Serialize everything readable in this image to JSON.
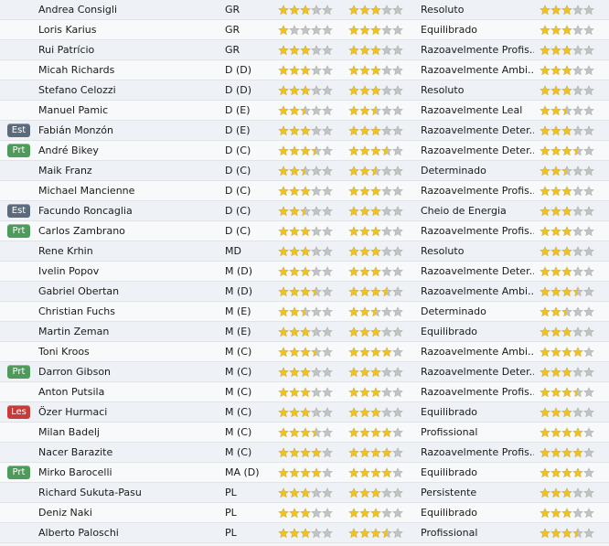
{
  "colors": {
    "Est": "#5b6b7d",
    "Prt": "#4e9a5a",
    "Les": "#c83b3b",
    "star_full": "#f2c21b",
    "star_empty": "#bfc4cb"
  },
  "rows": [
    {
      "name": "Andrea Consigli",
      "pos": "GR",
      "badge": "",
      "ca": 3,
      "pa": 3,
      "personality": "Resoluto",
      "r": 3
    },
    {
      "name": "Loris Karius",
      "pos": "GR",
      "badge": "",
      "ca": 1,
      "pa": 3,
      "personality": "Equilibrado",
      "r": 3
    },
    {
      "name": "Rui Patrício",
      "pos": "GR",
      "badge": "",
      "ca": 3,
      "pa": 3,
      "personality": "Razoavelmente Profis...",
      "r": 3
    },
    {
      "name": "Micah Richards",
      "pos": "D (D)",
      "badge": "",
      "ca": 3,
      "pa": 3,
      "personality": "Razoavelmente Ambi...",
      "r": 3
    },
    {
      "name": "Stefano Celozzi",
      "pos": "D (D)",
      "badge": "",
      "ca": 3,
      "pa": 3,
      "personality": "Resoluto",
      "r": 3
    },
    {
      "name": "Manuel Pamic",
      "pos": "D (E)",
      "badge": "",
      "ca": 2.5,
      "pa": 2.5,
      "personality": "Razoavelmente Leal",
      "r": 2.5
    },
    {
      "name": "Fabián Monzón",
      "pos": "D (E)",
      "badge": "Est",
      "ca": 3,
      "pa": 3,
      "personality": "Razoavelmente Deter...",
      "r": 3
    },
    {
      "name": "André Bikey",
      "pos": "D (C)",
      "badge": "Prt",
      "ca": 3.5,
      "pa": 3.5,
      "personality": "Razoavelmente Deter...",
      "r": 3.5
    },
    {
      "name": "Maik Franz",
      "pos": "D (C)",
      "badge": "",
      "ca": 2.5,
      "pa": 2.5,
      "personality": "Determinado",
      "r": 2.5
    },
    {
      "name": "Michael Mancienne",
      "pos": "D (C)",
      "badge": "",
      "ca": 3,
      "pa": 3,
      "personality": "Razoavelmente Profis...",
      "r": 3
    },
    {
      "name": "Facundo Roncaglia",
      "pos": "D (C)",
      "badge": "Est",
      "ca": 2.5,
      "pa": 3,
      "personality": "Cheio de Energia",
      "r": 3
    },
    {
      "name": "Carlos Zambrano",
      "pos": "D (C)",
      "badge": "Prt",
      "ca": 3,
      "pa": 3,
      "personality": "Razoavelmente Profis...",
      "r": 3
    },
    {
      "name": "Rene Krhin",
      "pos": "MD",
      "badge": "",
      "ca": 3,
      "pa": 3,
      "personality": "Resoluto",
      "r": 3
    },
    {
      "name": "Ivelin Popov",
      "pos": "M (D)",
      "badge": "",
      "ca": 3,
      "pa": 3,
      "personality": "Razoavelmente Deter...",
      "r": 3
    },
    {
      "name": "Gabriel Obertan",
      "pos": "M (D)",
      "badge": "",
      "ca": 3.5,
      "pa": 3.5,
      "personality": "Razoavelmente Ambi...",
      "r": 3.5
    },
    {
      "name": "Christian Fuchs",
      "pos": "M (E)",
      "badge": "",
      "ca": 2.5,
      "pa": 2.5,
      "personality": "Determinado",
      "r": 2.5
    },
    {
      "name": "Martin Zeman",
      "pos": "M (E)",
      "badge": "",
      "ca": 3,
      "pa": 3,
      "personality": "Equilibrado",
      "r": 3
    },
    {
      "name": "Toni Kroos",
      "pos": "M (C)",
      "badge": "",
      "ca": 3.5,
      "pa": 4,
      "personality": "Razoavelmente Ambi...",
      "r": 4
    },
    {
      "name": "Darron Gibson",
      "pos": "M (C)",
      "badge": "Prt",
      "ca": 3,
      "pa": 3,
      "personality": "Razoavelmente Deter...",
      "r": 3
    },
    {
      "name": "Anton Putsila",
      "pos": "M (C)",
      "badge": "",
      "ca": 3,
      "pa": 3,
      "personality": "Razoavelmente Profis...",
      "r": 3.5
    },
    {
      "name": "Özer Hurmaci",
      "pos": "M (C)",
      "badge": "Les",
      "ca": 3,
      "pa": 3,
      "personality": "Equilibrado",
      "r": 3
    },
    {
      "name": "Milan Badelj",
      "pos": "M (C)",
      "badge": "",
      "ca": 3.5,
      "pa": 4,
      "personality": "Profissional",
      "r": 4
    },
    {
      "name": "Nacer Barazite",
      "pos": "M (C)",
      "badge": "",
      "ca": 4,
      "pa": 4,
      "personality": "Razoavelmente Profis...",
      "r": 4
    },
    {
      "name": "Mirko Barocelli",
      "pos": "MA (D)",
      "badge": "Prt",
      "ca": 4,
      "pa": 4,
      "personality": "Equilibrado",
      "r": 4
    },
    {
      "name": "Richard Sukuta-Pasu",
      "pos": "PL",
      "badge": "",
      "ca": 3,
      "pa": 3,
      "personality": "Persistente",
      "r": 3
    },
    {
      "name": "Deniz Naki",
      "pos": "PL",
      "badge": "",
      "ca": 3,
      "pa": 3,
      "personality": "Equilibrado",
      "r": 3
    },
    {
      "name": "Alberto Paloschi",
      "pos": "PL",
      "badge": "",
      "ca": 3,
      "pa": 3.5,
      "personality": "Profissional",
      "r": 3.5
    }
  ]
}
